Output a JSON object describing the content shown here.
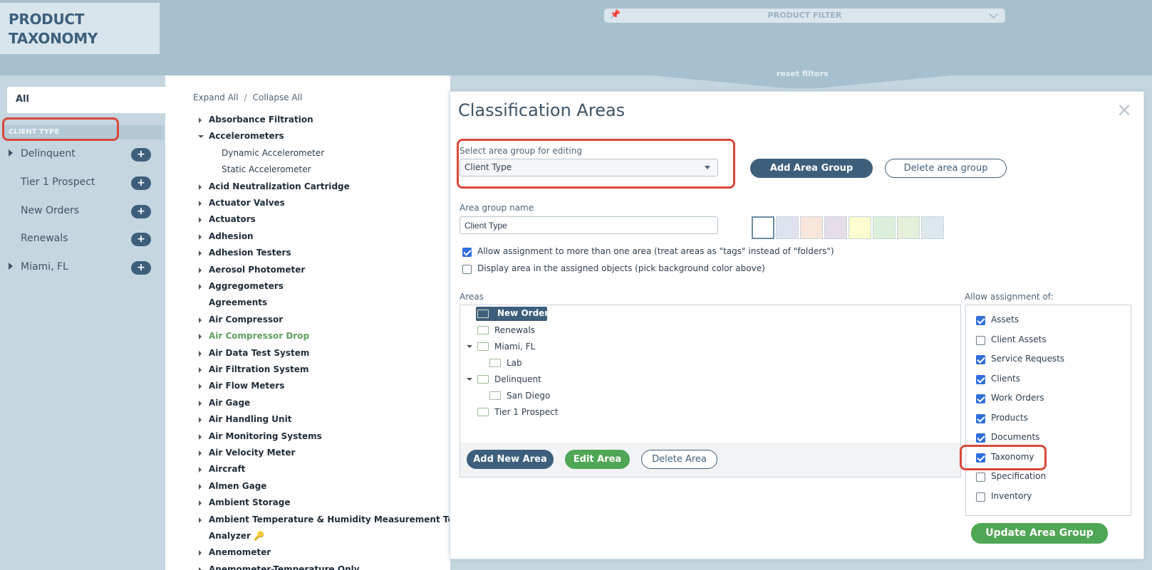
{
  "brand": {
    "line1": "PRODUCT",
    "line2": "TAXONOMY"
  },
  "filter": {
    "label": "PRODUCT FILTER",
    "pin_icon": "pin-icon",
    "reset_label": "reset filters"
  },
  "sidebar": {
    "all_label": "All",
    "group_header": "CLIENT TYPE",
    "items": [
      {
        "label": "Delinquent",
        "expandable": true
      },
      {
        "label": "Tier 1 Prospect",
        "expandable": false
      },
      {
        "label": "New Orders",
        "expandable": false
      },
      {
        "label": "Renewals",
        "expandable": false
      },
      {
        "label": "Miami, FL",
        "expandable": true
      }
    ],
    "add_symbol": "+"
  },
  "tree": {
    "expand_all": "Expand All",
    "separator": "/",
    "collapse_all": "Collapse All",
    "items": [
      {
        "label": "Absorbance Filtration",
        "state": "collapsed"
      },
      {
        "label": "Accelerometers",
        "state": "expanded"
      },
      {
        "label": "Dynamic Accelerometer",
        "state": "child"
      },
      {
        "label": "Static Accelerometer",
        "state": "child"
      },
      {
        "label": "Acid Neutralization Cartridge",
        "state": "collapsed"
      },
      {
        "label": "Actuator Valves",
        "state": "collapsed"
      },
      {
        "label": "Actuators",
        "state": "collapsed"
      },
      {
        "label": "Adhesion",
        "state": "collapsed"
      },
      {
        "label": "Adhesion Testers",
        "state": "collapsed"
      },
      {
        "label": "Aerosol Photometer",
        "state": "collapsed"
      },
      {
        "label": "Aggregometers",
        "state": "collapsed"
      },
      {
        "label": "Agreements",
        "state": "leaf"
      },
      {
        "label": "Air Compressor",
        "state": "collapsed"
      },
      {
        "label": "Air Compressor Drop",
        "state": "collapsed-green"
      },
      {
        "label": "Air Data Test System",
        "state": "collapsed"
      },
      {
        "label": "Air Filtration System",
        "state": "collapsed"
      },
      {
        "label": "Air Flow Meters",
        "state": "collapsed"
      },
      {
        "label": "Air Gage",
        "state": "collapsed"
      },
      {
        "label": "Air Handling Unit",
        "state": "collapsed"
      },
      {
        "label": "Air Monitoring Systems",
        "state": "collapsed"
      },
      {
        "label": "Air Velocity Meter",
        "state": "collapsed"
      },
      {
        "label": "Aircraft",
        "state": "collapsed"
      },
      {
        "label": "Almen Gage",
        "state": "collapsed"
      },
      {
        "label": "Ambient Storage",
        "state": "collapsed"
      },
      {
        "label": "Ambient Temperature & Humidity Measurement Tools",
        "state": "collapsed"
      },
      {
        "label": "Analyzer 🔑",
        "state": "leaf"
      },
      {
        "label": "Anemometer",
        "state": "collapsed"
      },
      {
        "label": "Anemometer-Temperature Only",
        "state": "collapsed"
      }
    ]
  },
  "modal": {
    "title": "Classification Areas",
    "close_symbol": "✕",
    "select_label": "Select area group for editing",
    "select_value": "Client Type",
    "add_group_button": "Add Area Group",
    "delete_group_button": "Delete area group",
    "group_name_label": "Area group name",
    "group_name_value": "Client Type",
    "swatches": [
      "#ffffff",
      "#dfe3ef",
      "#f7e6d9",
      "#e5dde8",
      "#fdfdcf",
      "#dcefd8",
      "#e6efd8",
      "#dde8ee"
    ],
    "opt_multi": "Allow assignment to more than one area (treat areas as \"tags\" instead of \"folders\")",
    "opt_multi_checked": true,
    "opt_display": "Display area in the assigned objects (pick background color above)",
    "opt_display_checked": false,
    "areas_label": "Areas",
    "areas": [
      {
        "label": "New Orders",
        "depth": 0,
        "selected": true,
        "expanded": null
      },
      {
        "label": "Renewals",
        "depth": 0,
        "selected": false,
        "expanded": null
      },
      {
        "label": "Miami, FL",
        "depth": 0,
        "selected": false,
        "expanded": true
      },
      {
        "label": "Lab",
        "depth": 1,
        "selected": false,
        "expanded": null
      },
      {
        "label": "Delinquent",
        "depth": 0,
        "selected": false,
        "expanded": true
      },
      {
        "label": "San Diego",
        "depth": 1,
        "selected": false,
        "expanded": null
      },
      {
        "label": "Tier 1 Prospect",
        "depth": 0,
        "selected": false,
        "expanded": null
      }
    ],
    "add_area_button": "Add New Area",
    "edit_area_button": "Edit Area",
    "delete_area_button": "Delete Area",
    "allow_label": "Allow assignment of:",
    "allow_items": [
      {
        "label": "Assets",
        "checked": true
      },
      {
        "label": "Client Assets",
        "checked": false
      },
      {
        "label": "Service Requests",
        "checked": true
      },
      {
        "label": "Clients",
        "checked": true
      },
      {
        "label": "Work Orders",
        "checked": true
      },
      {
        "label": "Products",
        "checked": true
      },
      {
        "label": "Documents",
        "checked": true
      },
      {
        "label": "Taxonomy",
        "checked": true
      },
      {
        "label": "Specification",
        "checked": false
      },
      {
        "label": "Inventory",
        "checked": false
      }
    ],
    "update_button": "Update Area Group"
  },
  "colors": {
    "accent": "#3e5f7c",
    "green": "#4fa655",
    "highlight": "#d9483b",
    "checkbox": "#2f6fdb"
  }
}
